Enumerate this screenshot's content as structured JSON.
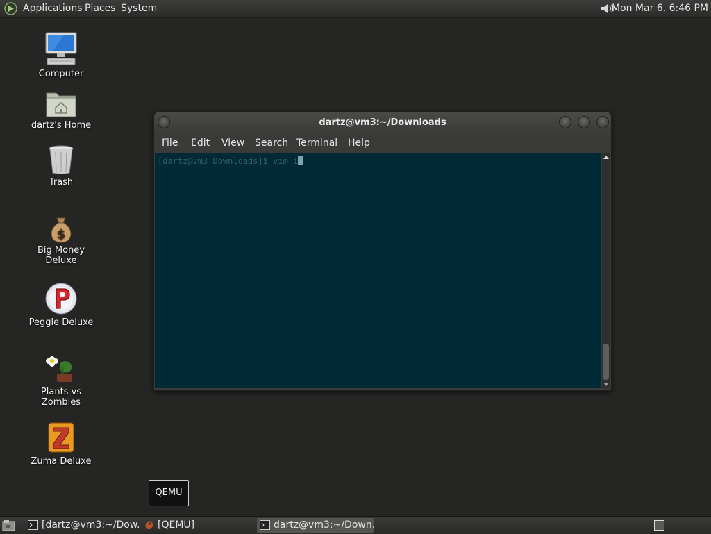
{
  "top_panel": {
    "menus": [
      "Applications",
      "Places",
      "System"
    ],
    "clock": "Mon Mar  6,  6:46 PM"
  },
  "desktop_icons": [
    {
      "label": "Computer",
      "icon": "computer-icon"
    },
    {
      "label": "dartz's Home",
      "icon": "home-folder-icon"
    },
    {
      "label": "Trash",
      "icon": "trash-icon"
    },
    {
      "label": "Big Money Deluxe",
      "icon": "money-bag-icon"
    },
    {
      "label": "Peggle Deluxe",
      "icon": "peggle-icon"
    },
    {
      "label": "Plants vs Zombies",
      "icon": "plants-vs-zombies-icon"
    },
    {
      "label": "Zuma Deluxe",
      "icon": "zuma-icon"
    }
  ],
  "terminal": {
    "title": "dartz@vm3:~/Downloads",
    "menu": [
      "File",
      "Edit",
      "View",
      "Search",
      "Terminal",
      "Help"
    ],
    "prompt_line": "[dartz@vm3 Downloads]$ vim i",
    "background_color": "#002b36"
  },
  "tooltip": {
    "text": "QEMU"
  },
  "taskbar": {
    "tasks": [
      {
        "label": "[dartz@vm3:~/Dow...",
        "icon": "terminal-icon",
        "active": false
      },
      {
        "label": "[QEMU]",
        "icon": "qemu-icon",
        "active": false
      },
      {
        "label": "dartz@vm3:~/Down...",
        "icon": "terminal-icon",
        "active": true
      }
    ]
  }
}
